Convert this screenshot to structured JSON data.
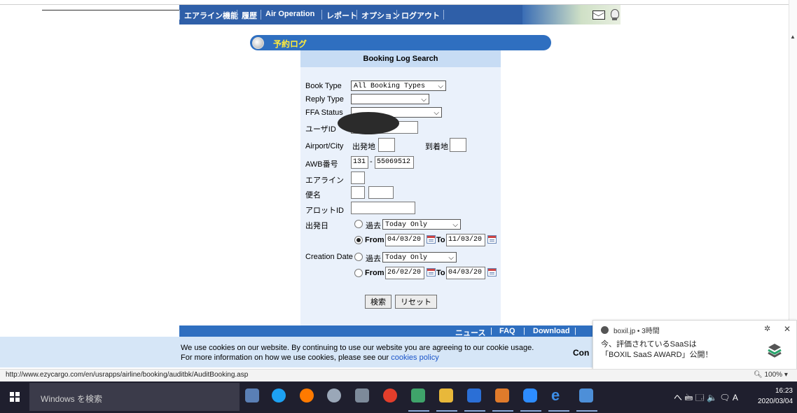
{
  "nav": {
    "items": [
      "エアライン機能",
      "履歴",
      "Air Operation",
      "レポート",
      "オプション",
      "ログアウト"
    ]
  },
  "section": {
    "title": "予約ログ"
  },
  "panel": {
    "title": "Booking Log Search",
    "book_type": {
      "label": "Book Type",
      "value": "All Booking Types"
    },
    "reply_type": {
      "label": "Reply Type",
      "value": ""
    },
    "ffa_status": {
      "label": "FFA Status",
      "value": ""
    },
    "user_id": {
      "label": "ユーザID",
      "value": ""
    },
    "airport": {
      "label": "Airport/City",
      "origin_label": "出発地",
      "dest_label": "到着地"
    },
    "awb": {
      "label": "AWB番号",
      "prefix": "131",
      "sep": "-",
      "number": "55069512"
    },
    "airline": {
      "label": "エアライン"
    },
    "flight": {
      "label": "便名"
    },
    "allotment": {
      "label": "アロットID"
    },
    "departure": {
      "label": "出発日",
      "past_label": "過去",
      "past_value": "Today Only",
      "from_label": "From",
      "from_value": "04/03/20",
      "to_label": "To",
      "to_value": "11/03/20"
    },
    "creation": {
      "label": "Creation Date",
      "past_label": "過去",
      "past_value": "Today Only",
      "from_label": "From",
      "from_value": "26/02/20",
      "to_label": "To",
      "to_value": "04/03/20"
    },
    "search_button": "検索",
    "reset_button": "リセット"
  },
  "footer": {
    "news": "ニュース",
    "faq": "FAQ",
    "download": "Download",
    "sep": "|"
  },
  "cookie": {
    "line1": "We use cookies on our website. By continuing to use our website you are agreeing to our cookie usage.",
    "line2_prefix": "For more information on how we use cookies, please see our ",
    "link": "cookies policy",
    "button": "Con"
  },
  "notification": {
    "source": "boxil.jp • 3時間",
    "line1": "今、評価されているSaaSは",
    "line2": "「BOXIL SaaS AWARD」公開！"
  },
  "status": {
    "url": "http://www.ezycargo.com/en/usrapps/airline/booking/auditbk/AuditBooking.asp",
    "zoom": "100%"
  },
  "taskbar": {
    "search_placeholder": "Windows を検索",
    "tray": "へ 🖮 🗔 🔈 🗨 A",
    "time": "16:23",
    "date": "2020/03/04"
  },
  "colors": {
    "nav": "#2f5fa8",
    "header": "#2f6fc0",
    "panel": "#eaf1fb",
    "taskbar": "#1f1f2e"
  }
}
